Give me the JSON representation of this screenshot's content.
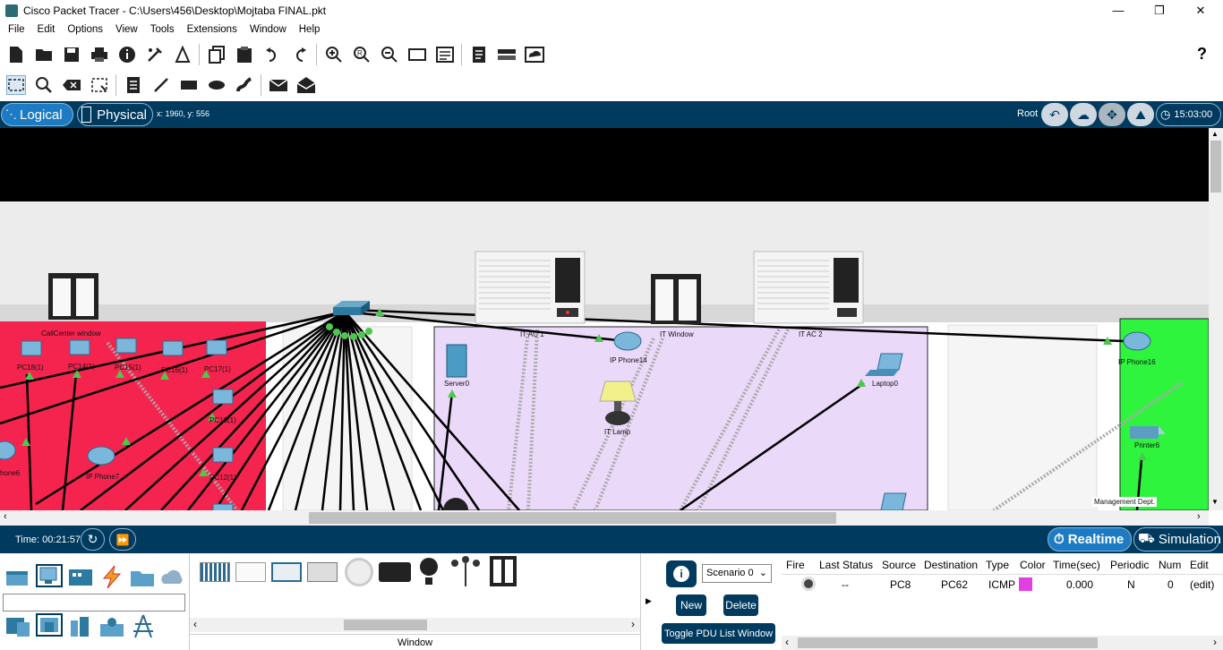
{
  "window": {
    "title": "Cisco Packet Tracer - C:\\Users\\456\\Desktop\\Mojtaba FINAL.pkt",
    "minimize": "—",
    "maximize": "❐",
    "close": "✕"
  },
  "menu": [
    "File",
    "Edit",
    "Options",
    "View",
    "Tools",
    "Extensions",
    "Window",
    "Help"
  ],
  "toolbar_main": {
    "icons": [
      "new-file-icon",
      "open-folder-icon",
      "save-icon",
      "print-icon",
      "info-icon",
      "activity-wizard-icon",
      "pt-icon",
      "copy-icon",
      "paste-icon",
      "undo-icon",
      "redo-icon",
      "zoom-in-icon",
      "zoom-reset-icon",
      "zoom-out-icon",
      "drawing-palette-icon",
      "custom-device-icon",
      "notes-icon",
      "viewport-icon",
      "cluster-icon"
    ],
    "help": "?"
  },
  "toolbar_secondary": {
    "icons": [
      "select-icon",
      "inspect-icon",
      "delete-icon",
      "resize-icon",
      "note-icon",
      "line-icon",
      "rectangle-icon",
      "ellipse-icon",
      "freeform-icon",
      "simple-pdu-icon",
      "complex-pdu-icon"
    ]
  },
  "modebar": {
    "logical": "Logical",
    "physical": "Physical",
    "coords": "x: 1960, y: 556",
    "root": "Root",
    "time": "15:03:00",
    "icons": [
      "back-icon",
      "cloud-icon",
      "move-icon",
      "background-icon",
      "clock-icon"
    ]
  },
  "canvas": {
    "labels": {
      "callcenter_window": "CallCenter window",
      "pc18": "PC18(1)",
      "pc14": "PC14(1)",
      "pc15": "PC15(1)",
      "pc16": "PC16(1)",
      "pc17": "PC17(1)",
      "pc13": "PC13(1)",
      "phone6": "hone6",
      "phone7": "IP Phone7",
      "pc12": "PC12(1)",
      "itac1": "IT AC 1",
      "itwindow": "IT Window",
      "itac2": "IT AC 2",
      "ipphone14": "IP Phone14",
      "server0": "Server0",
      "itlamp": "IT Lamp",
      "laptop0": "Laptop0",
      "ipphone16": "IP Phone16",
      "printer6": "Printer6",
      "mgmt": "Management Dept."
    },
    "colors": {
      "red_room": "#f5244f",
      "purple_room": "#ebd9fa",
      "green_room": "#2ef43e",
      "gray_room": "#f2f2f2"
    }
  },
  "status": {
    "time_label": "Time: 00:21:57",
    "realtime": "Realtime",
    "simulation": "Simulation"
  },
  "bottom": {
    "search_placeholder": "",
    "window_label": "Window",
    "scenario": "Scenario 0",
    "new": "New",
    "delete": "Delete",
    "toggle": "Toggle PDU List Window",
    "info": "i",
    "pdu_headers": [
      "Fire",
      "Last Status",
      "Source",
      "Destination",
      "Type",
      "Color",
      "Time(sec)",
      "Periodic",
      "Num",
      "Edit"
    ],
    "pdu_row": {
      "last_status": "--",
      "source": "PC8",
      "destination": "PC62",
      "type": "ICMP",
      "color": "#e040e0",
      "time": "0.000",
      "periodic": "N",
      "num": "0",
      "edit": "(edit)"
    }
  }
}
